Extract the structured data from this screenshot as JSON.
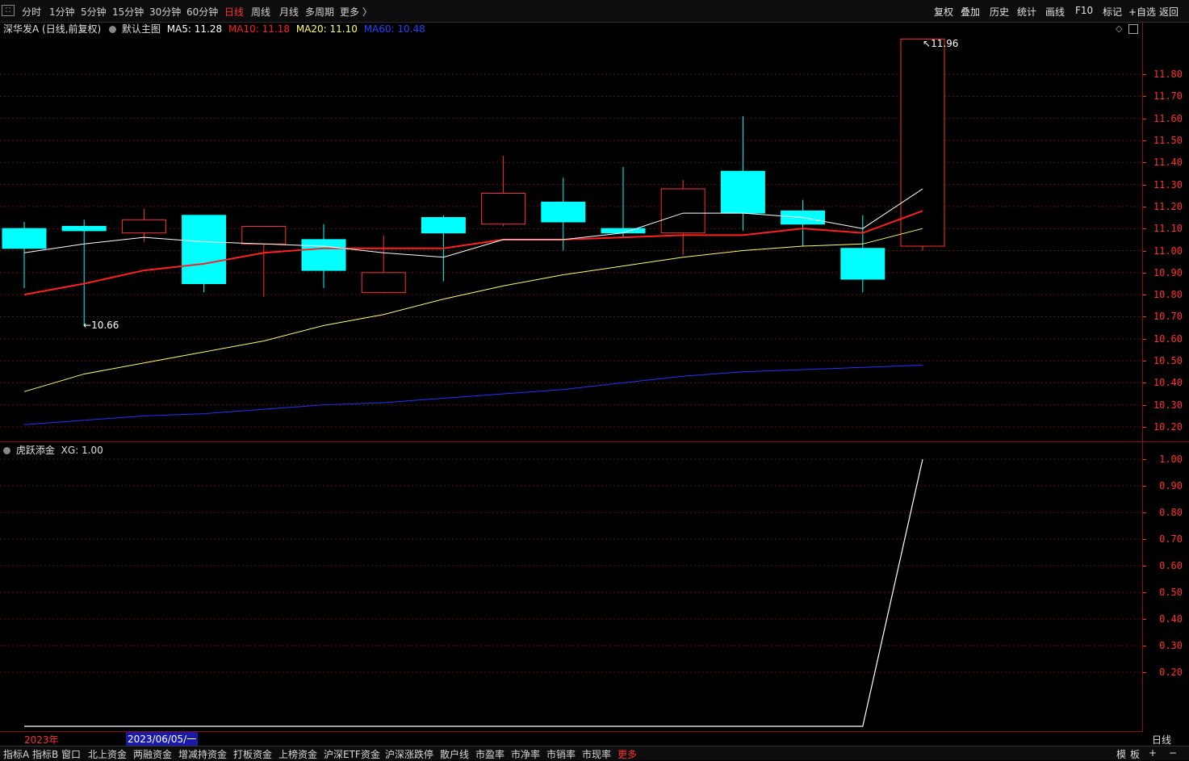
{
  "topbar": {
    "left_items": [
      "分时",
      "1分钟",
      "5分钟",
      "15分钟",
      "30分钟",
      "60分钟",
      "日线",
      "周线",
      "月线",
      "多周期",
      "更多 〉"
    ],
    "active_item": "日线",
    "right_items": [
      "复权",
      "叠加",
      "历史",
      "统计",
      "画线",
      "F10",
      "标记",
      "+自选",
      "返回"
    ]
  },
  "main_header": {
    "stock": "深华发A (日线,前复权)",
    "template": "默认主图",
    "ma5": "MA5: 11.28",
    "ma10": "MA10: 11.18",
    "ma20": "MA20: 11.10",
    "ma60": "MA60: 10.48"
  },
  "indicator_header": {
    "name": "虎跃添金",
    "xg": "XG: 1.00"
  },
  "annotations": {
    "high": "11.96",
    "low": "10.66"
  },
  "price_axis": [
    "11.80",
    "11.70",
    "11.60",
    "11.50",
    "11.40",
    "11.30",
    "11.20",
    "11.10",
    "11.00",
    "10.90",
    "10.80",
    "10.70",
    "10.60",
    "10.50",
    "10.40",
    "10.30",
    "10.20"
  ],
  "ind_axis": [
    "1.00",
    "0.90",
    "0.80",
    "0.70",
    "0.60",
    "0.50",
    "0.40",
    "0.30",
    "0.20"
  ],
  "date_bar": {
    "year": "2023年",
    "cursor": "2023/06/05/一",
    "period": "日线"
  },
  "bottom_tabs": [
    "指标A",
    "指标B",
    "窗口",
    "北上资金",
    "两融资金",
    "增减持资金",
    "打板资金",
    "上榜资金",
    "沪深ETF资金",
    "沪深涨跌停",
    "散户线",
    "市盈率",
    "市净率",
    "市销率",
    "市现率",
    "更多"
  ],
  "bottom_right": [
    "模",
    "板",
    "+",
    "−"
  ],
  "colors": {
    "up": "#ff3030",
    "down": "#00ffff",
    "ma5": "#ffffff",
    "ma10": "#ff2020",
    "ma20": "#ffff66",
    "ma60": "#2233ff",
    "axis": "#ff3030"
  },
  "chart_data": {
    "type": "candlestick",
    "price_range": [
      10.15,
      11.98
    ],
    "candles": [
      {
        "o": 11.1,
        "c": 11.01,
        "h": 11.13,
        "l": 10.83
      },
      {
        "o": 11.11,
        "c": 11.09,
        "h": 11.14,
        "l": 10.66
      },
      {
        "o": 11.08,
        "c": 11.14,
        "h": 11.19,
        "l": 11.04
      },
      {
        "o": 11.16,
        "c": 10.85,
        "h": 11.16,
        "l": 10.81
      },
      {
        "o": 11.03,
        "c": 11.11,
        "h": 11.11,
        "l": 10.79
      },
      {
        "o": 11.05,
        "c": 10.91,
        "h": 11.12,
        "l": 10.83
      },
      {
        "o": 10.81,
        "c": 10.9,
        "h": 11.07,
        "l": 10.81
      },
      {
        "o": 11.15,
        "c": 11.08,
        "h": 11.16,
        "l": 10.86
      },
      {
        "o": 11.12,
        "c": 11.26,
        "h": 11.43,
        "l": 11.11
      },
      {
        "o": 11.22,
        "c": 11.13,
        "h": 11.33,
        "l": 11.0
      },
      {
        "o": 11.1,
        "c": 11.08,
        "h": 11.38,
        "l": 11.06
      },
      {
        "o": 11.08,
        "c": 11.28,
        "h": 11.32,
        "l": 10.98
      },
      {
        "o": 11.36,
        "c": 11.17,
        "h": 11.61,
        "l": 11.09
      },
      {
        "o": 11.18,
        "c": 11.12,
        "h": 11.23,
        "l": 11.02
      },
      {
        "o": 11.01,
        "c": 10.87,
        "h": 11.16,
        "l": 10.81
      },
      {
        "o": 11.02,
        "c": 11.96,
        "h": 11.96,
        "l": 11.0
      }
    ],
    "ma5": [
      10.99,
      11.03,
      11.06,
      11.04,
      11.03,
      11.02,
      10.99,
      10.97,
      11.05,
      11.05,
      11.08,
      11.17,
      11.17,
      11.15,
      11.1,
      11.28
    ],
    "ma10": [
      10.8,
      10.85,
      10.91,
      10.94,
      10.99,
      11.01,
      11.01,
      11.01,
      11.05,
      11.05,
      11.06,
      11.07,
      11.07,
      11.1,
      11.08,
      11.18
    ],
    "ma20": [
      10.36,
      10.44,
      10.49,
      10.54,
      10.59,
      10.66,
      10.71,
      10.78,
      10.84,
      10.89,
      10.93,
      10.97,
      11.0,
      11.02,
      11.03,
      11.1
    ],
    "ma60": [
      10.21,
      10.23,
      10.25,
      10.26,
      10.28,
      10.3,
      10.31,
      10.33,
      10.35,
      10.37,
      10.4,
      10.43,
      10.45,
      10.46,
      10.47,
      10.48
    ],
    "xg": [
      0,
      0,
      0,
      0,
      0,
      0,
      0,
      0,
      0,
      0,
      0,
      0,
      0,
      0,
      0,
      1
    ],
    "xg_range": [
      0,
      1
    ]
  }
}
